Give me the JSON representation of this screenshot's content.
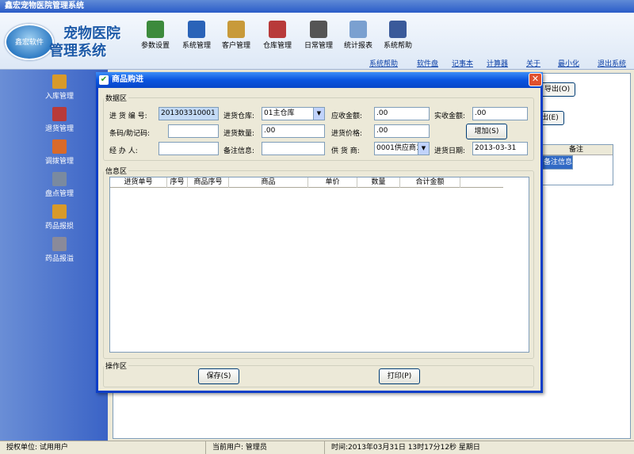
{
  "app": {
    "title": "鑫宏宠物医院管理系统",
    "logo_text": "鑫宏软件",
    "name_line1": "宠物医院",
    "name_line2": "管理系统"
  },
  "toolbar": [
    {
      "label": "参数设置",
      "icon": "settings-icon",
      "color": "#3c8a3c"
    },
    {
      "label": "系统管理",
      "icon": "system-icon",
      "color": "#2a63b8"
    },
    {
      "label": "客户管理",
      "icon": "house-icon",
      "color": "#c89a3a"
    },
    {
      "label": "仓库管理",
      "icon": "warehouse-icon",
      "color": "#b83a3a"
    },
    {
      "label": "日常管理",
      "icon": "calendar-icon",
      "color": "#555555"
    },
    {
      "label": "统计报表",
      "icon": "report-icon",
      "color": "#7aa0d0"
    },
    {
      "label": "系统帮助",
      "icon": "computer-icon",
      "color": "#3a5a9a"
    }
  ],
  "topnav": [
    "系统帮助",
    "软件盘",
    "记事本",
    "计算器",
    "关于",
    "最小化",
    "退出系统"
  ],
  "sidebar": [
    {
      "label": "入库管理",
      "icon": "clipboard-icon",
      "color": "#d89a2a"
    },
    {
      "label": "退货管理",
      "icon": "bottles-icon",
      "color": "#b83a3a"
    },
    {
      "label": "调拨管理",
      "icon": "people-icon",
      "color": "#d86a2a"
    },
    {
      "label": "盘点管理",
      "icon": "gear-monitor-icon",
      "color": "#7a8aa0"
    },
    {
      "label": "药品报损",
      "icon": "clipboard-icon",
      "color": "#d89a2a"
    },
    {
      "label": "药品报溢",
      "icon": "gears-icon",
      "color": "#8a8a9a"
    }
  ],
  "background": {
    "export_btn1": "导出(O)",
    "export_btn2": "出(E)",
    "table_header": "备注",
    "table_selected": "备注信息"
  },
  "dialog": {
    "title": "商品购进",
    "data_section": "数据区",
    "info_section": "信息区",
    "op_section": "操作区",
    "fields": {
      "purchase_no_label": "进 货 编 号:",
      "purchase_no": "201303310001",
      "warehouse_label": "进货仓库:",
      "warehouse": "01主仓库",
      "receivable_label": "应收金额:",
      "receivable": ".00",
      "received_label": "实收金额:",
      "received": ".00",
      "barcode_label": "条码/助记码:",
      "barcode": "",
      "qty_label": "进货数量:",
      "qty": ".00",
      "price_label": "进货价格:",
      "price": ".00",
      "handler_label": "经    办  人:",
      "handler": "",
      "remark_label": "备注信息:",
      "remark": "",
      "supplier_label": "供 货 商:",
      "supplier": "0001供应商1",
      "date_label": "进货日期:",
      "date": "2013-03-31"
    },
    "add_button": "增加(S)",
    "grid_columns": [
      "进货单号",
      "序号",
      "商品序号",
      "商品",
      "单价",
      "数量",
      "合计金额"
    ],
    "save_button": "保存(S)",
    "print_button": "打印(P)"
  },
  "status": {
    "unit": "授权单位: 试用用户",
    "user": "当前用户: 管理员",
    "time": "时间:2013年03月31日  13时17分12秒  星期日"
  }
}
